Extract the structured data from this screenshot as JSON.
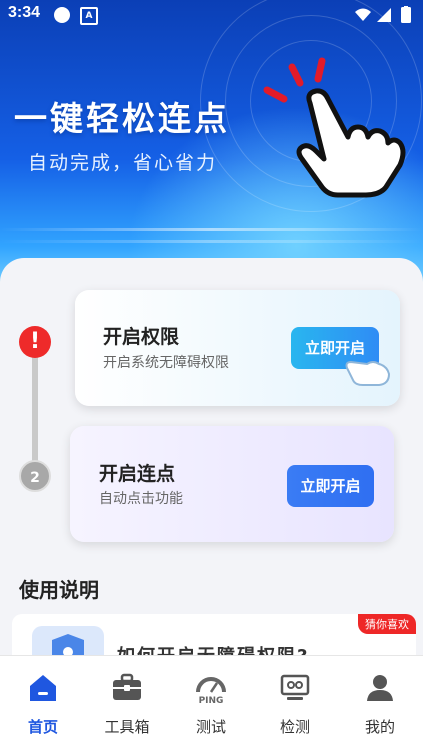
{
  "status_bar": {
    "time": "3:34"
  },
  "hero": {
    "headline": "一键轻松连点",
    "subheadline": "自动完成，省心省力"
  },
  "steps": [
    {
      "marker": "!",
      "title": "开启权限",
      "description": "开启系统无障碍权限",
      "button_label": "立即开启"
    },
    {
      "marker": "2",
      "title": "开启连点",
      "description": "自动点击功能",
      "button_label": "立即开启"
    }
  ],
  "instructions": {
    "section_title": "使用说明",
    "badge": "猜你喜欢",
    "first_item_text": "如何开启无障碍权限?"
  },
  "tabs": [
    {
      "label": "首页",
      "icon": "home-icon",
      "active": true
    },
    {
      "label": "工具箱",
      "icon": "toolbox-icon",
      "active": false
    },
    {
      "label": "测试",
      "icon": "ping-gauge-icon",
      "active": false,
      "icon_text": "PING"
    },
    {
      "label": "检测",
      "icon": "monitor-icon",
      "active": false
    },
    {
      "label": "我的",
      "icon": "profile-icon",
      "active": false
    }
  ],
  "colors": {
    "accent": "#1f57e0",
    "alert": "#ee2a2a",
    "badge": "#ee2727"
  }
}
